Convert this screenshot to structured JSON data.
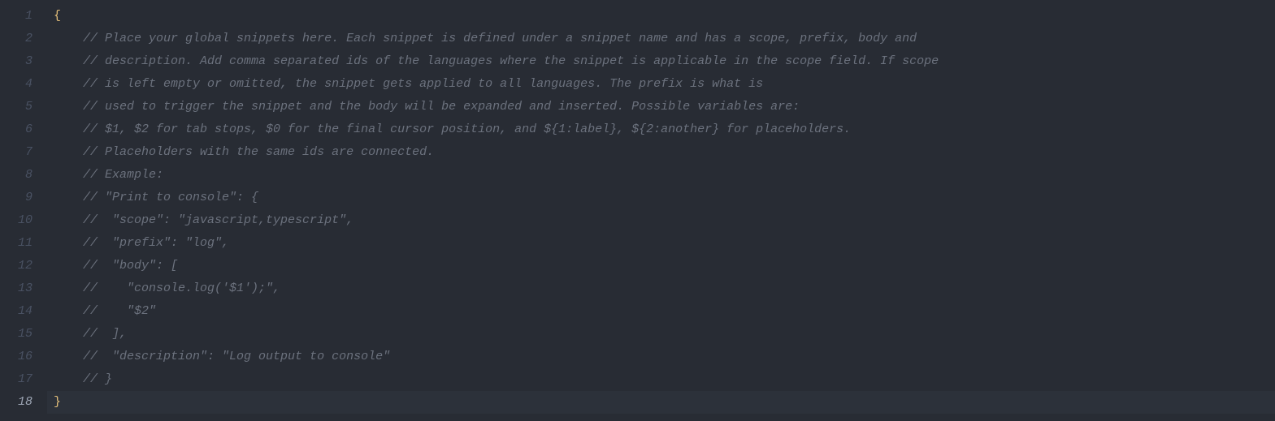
{
  "editor": {
    "activeLine": 18,
    "lines": [
      {
        "num": 1,
        "indent": 0,
        "kind": "brace",
        "text": "{"
      },
      {
        "num": 2,
        "indent": 1,
        "kind": "comment",
        "text": "// Place your global snippets here. Each snippet is defined under a snippet name and has a scope, prefix, body and"
      },
      {
        "num": 3,
        "indent": 1,
        "kind": "comment",
        "text": "// description. Add comma separated ids of the languages where the snippet is applicable in the scope field. If scope"
      },
      {
        "num": 4,
        "indent": 1,
        "kind": "comment",
        "text": "// is left empty or omitted, the snippet gets applied to all languages. The prefix is what is"
      },
      {
        "num": 5,
        "indent": 1,
        "kind": "comment",
        "text": "// used to trigger the snippet and the body will be expanded and inserted. Possible variables are:"
      },
      {
        "num": 6,
        "indent": 1,
        "kind": "comment",
        "text": "// $1, $2 for tab stops, $0 for the final cursor position, and ${1:label}, ${2:another} for placeholders."
      },
      {
        "num": 7,
        "indent": 1,
        "kind": "comment",
        "text": "// Placeholders with the same ids are connected."
      },
      {
        "num": 8,
        "indent": 1,
        "kind": "comment",
        "text": "// Example:"
      },
      {
        "num": 9,
        "indent": 1,
        "kind": "comment",
        "text": "// \"Print to console\": {"
      },
      {
        "num": 10,
        "indent": 1,
        "kind": "comment",
        "text": "//  \"scope\": \"javascript,typescript\","
      },
      {
        "num": 11,
        "indent": 1,
        "kind": "comment",
        "text": "//  \"prefix\": \"log\","
      },
      {
        "num": 12,
        "indent": 1,
        "kind": "comment",
        "text": "//  \"body\": ["
      },
      {
        "num": 13,
        "indent": 1,
        "kind": "comment",
        "text": "//    \"console.log('$1');\","
      },
      {
        "num": 14,
        "indent": 1,
        "kind": "comment",
        "text": "//    \"$2\""
      },
      {
        "num": 15,
        "indent": 1,
        "kind": "comment",
        "text": "//  ],"
      },
      {
        "num": 16,
        "indent": 1,
        "kind": "comment",
        "text": "//  \"description\": \"Log output to console\""
      },
      {
        "num": 17,
        "indent": 1,
        "kind": "comment",
        "text": "// }"
      },
      {
        "num": 18,
        "indent": 0,
        "kind": "brace",
        "text": "}"
      }
    ]
  }
}
